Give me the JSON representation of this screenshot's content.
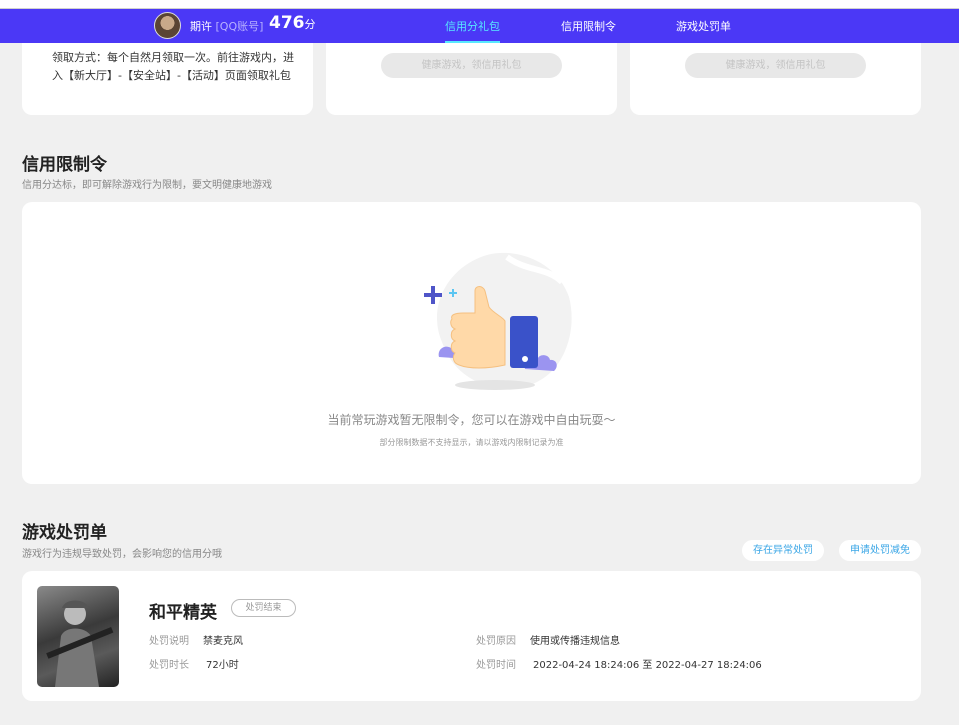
{
  "nav": {
    "user_name": "期许",
    "account_tag": "[QQ账号]",
    "score": "476",
    "score_unit": "分",
    "tabs": [
      "信用分礼包",
      "信用限制令",
      "游戏处罚单"
    ]
  },
  "gift": {
    "desc": "领取方式：每个自然月领取一次。前往游戏内，进入【新大厅】-【安全站】-【活动】页面领取礼包",
    "btn_label": "健康游戏，领信用礼包"
  },
  "restriction": {
    "title": "信用限制令",
    "subtitle": "信用分达标，即可解除游戏行为限制，要文明健康地游戏",
    "empty_text": "当前常玩游戏暂无限制令，您可以在游戏中自由玩耍～",
    "empty_note": "部分限制数据不支持显示，请以游戏内限制记录为准"
  },
  "penalty": {
    "title": "游戏处罚单",
    "subtitle": "游戏行为违规导致处罚，会影响您的信用分哦",
    "btn_abnormal": "存在异常处罚",
    "btn_appeal": "申请处罚减免",
    "item": {
      "game": "和平精英",
      "status": "处罚结束",
      "desc_label": "处罚说明",
      "desc_value": "禁麦克风",
      "reason_label": "处罚原因",
      "reason_value": "使用或传播违规信息",
      "duration_label": "处罚时长",
      "duration_value": "72小时",
      "time_label": "处罚时间",
      "time_value": "2022-04-24 18:24:06 至 2022-04-27 18:24:06"
    }
  },
  "colors": {
    "nav_bg": "#4b38f6",
    "active_tab": "#57e8ff",
    "link_blue": "#3aa6e6"
  }
}
